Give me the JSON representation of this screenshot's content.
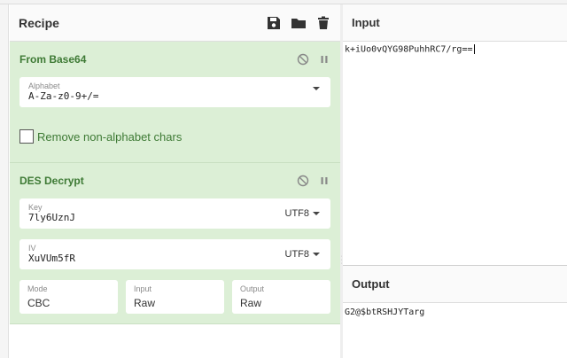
{
  "recipe": {
    "title": "Recipe",
    "actions": [
      "save-icon",
      "folder-icon",
      "trash-icon"
    ]
  },
  "operations": [
    {
      "title": "From Base64",
      "alphabet_label": "Alphabet",
      "alphabet_value": "A-Za-z0-9+/=",
      "checkbox_label": "Remove non-alphabet chars",
      "checkbox_checked": false
    },
    {
      "title": "DES Decrypt",
      "key_label": "Key",
      "key_value": "7ly6UznJ",
      "key_encoding": "UTF8",
      "iv_label": "IV",
      "iv_value": "XuVUm5fR",
      "iv_encoding": "UTF8",
      "mode_label": "Mode",
      "mode_value": "CBC",
      "input_label": "Input",
      "input_value": "Raw",
      "output_label": "Output",
      "output_value": "Raw"
    }
  ],
  "input": {
    "title": "Input",
    "text": "k+iUo0vQYG98PuhhRC7/rg=="
  },
  "output": {
    "title": "Output",
    "text": "G2@$btRSHJYTarg"
  },
  "colors": {
    "op_background": "#dcefd6",
    "op_title": "#3e7a35"
  }
}
